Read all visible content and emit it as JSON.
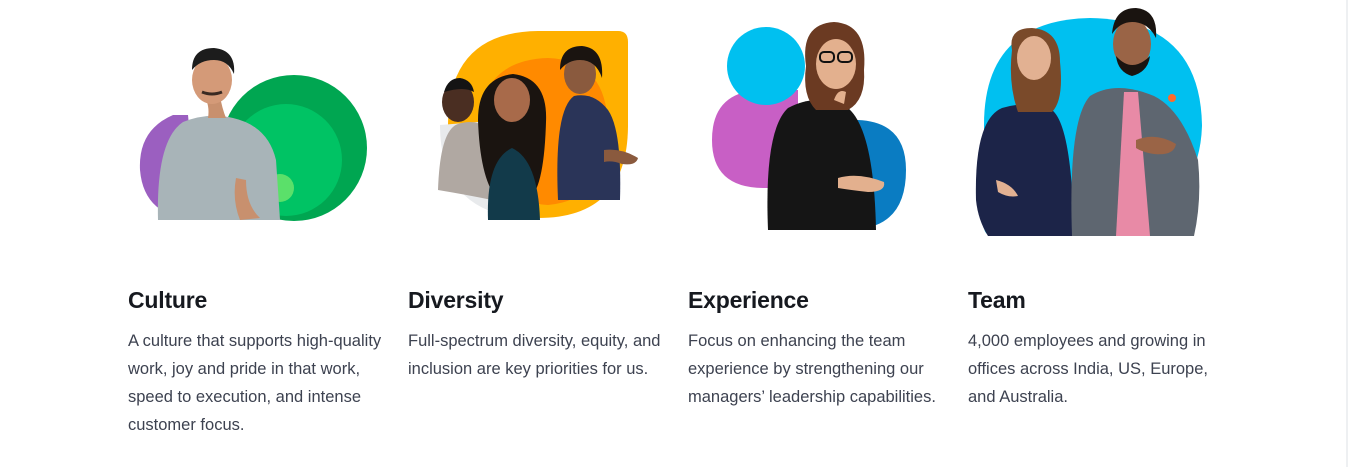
{
  "colors": {
    "heading": "#16191f",
    "body_text": "#3d4250",
    "green_dark": "#00a651",
    "green_light": "#00c364",
    "purple": "#9b5fc0",
    "magenta": "#c85fc5",
    "yellow": "#ffb000",
    "orange": "#ff8a00",
    "cyan": "#00c0f0",
    "blue": "#0a7cc2"
  },
  "cards": [
    {
      "title": "Culture",
      "text": "A culture that supports high-quality work, joy and pride in that work, speed to execution, and intense customer focus.",
      "illustration": "person-with-green-circles"
    },
    {
      "title": "Diversity",
      "text": "Full-spectrum diversity, equity, and inclusion are key priorities for us.",
      "illustration": "group-with-yellow-shape"
    },
    {
      "title": "Experience",
      "text": "Focus on enhancing the team experience by strengthening our managers’ leadership capabilities.",
      "illustration": "woman-with-blue-shapes"
    },
    {
      "title": "Team",
      "text": "4,000 employees and growing in offices across India, US, Europe, and Australia.",
      "illustration": "pair-with-cyan-shape"
    }
  ]
}
